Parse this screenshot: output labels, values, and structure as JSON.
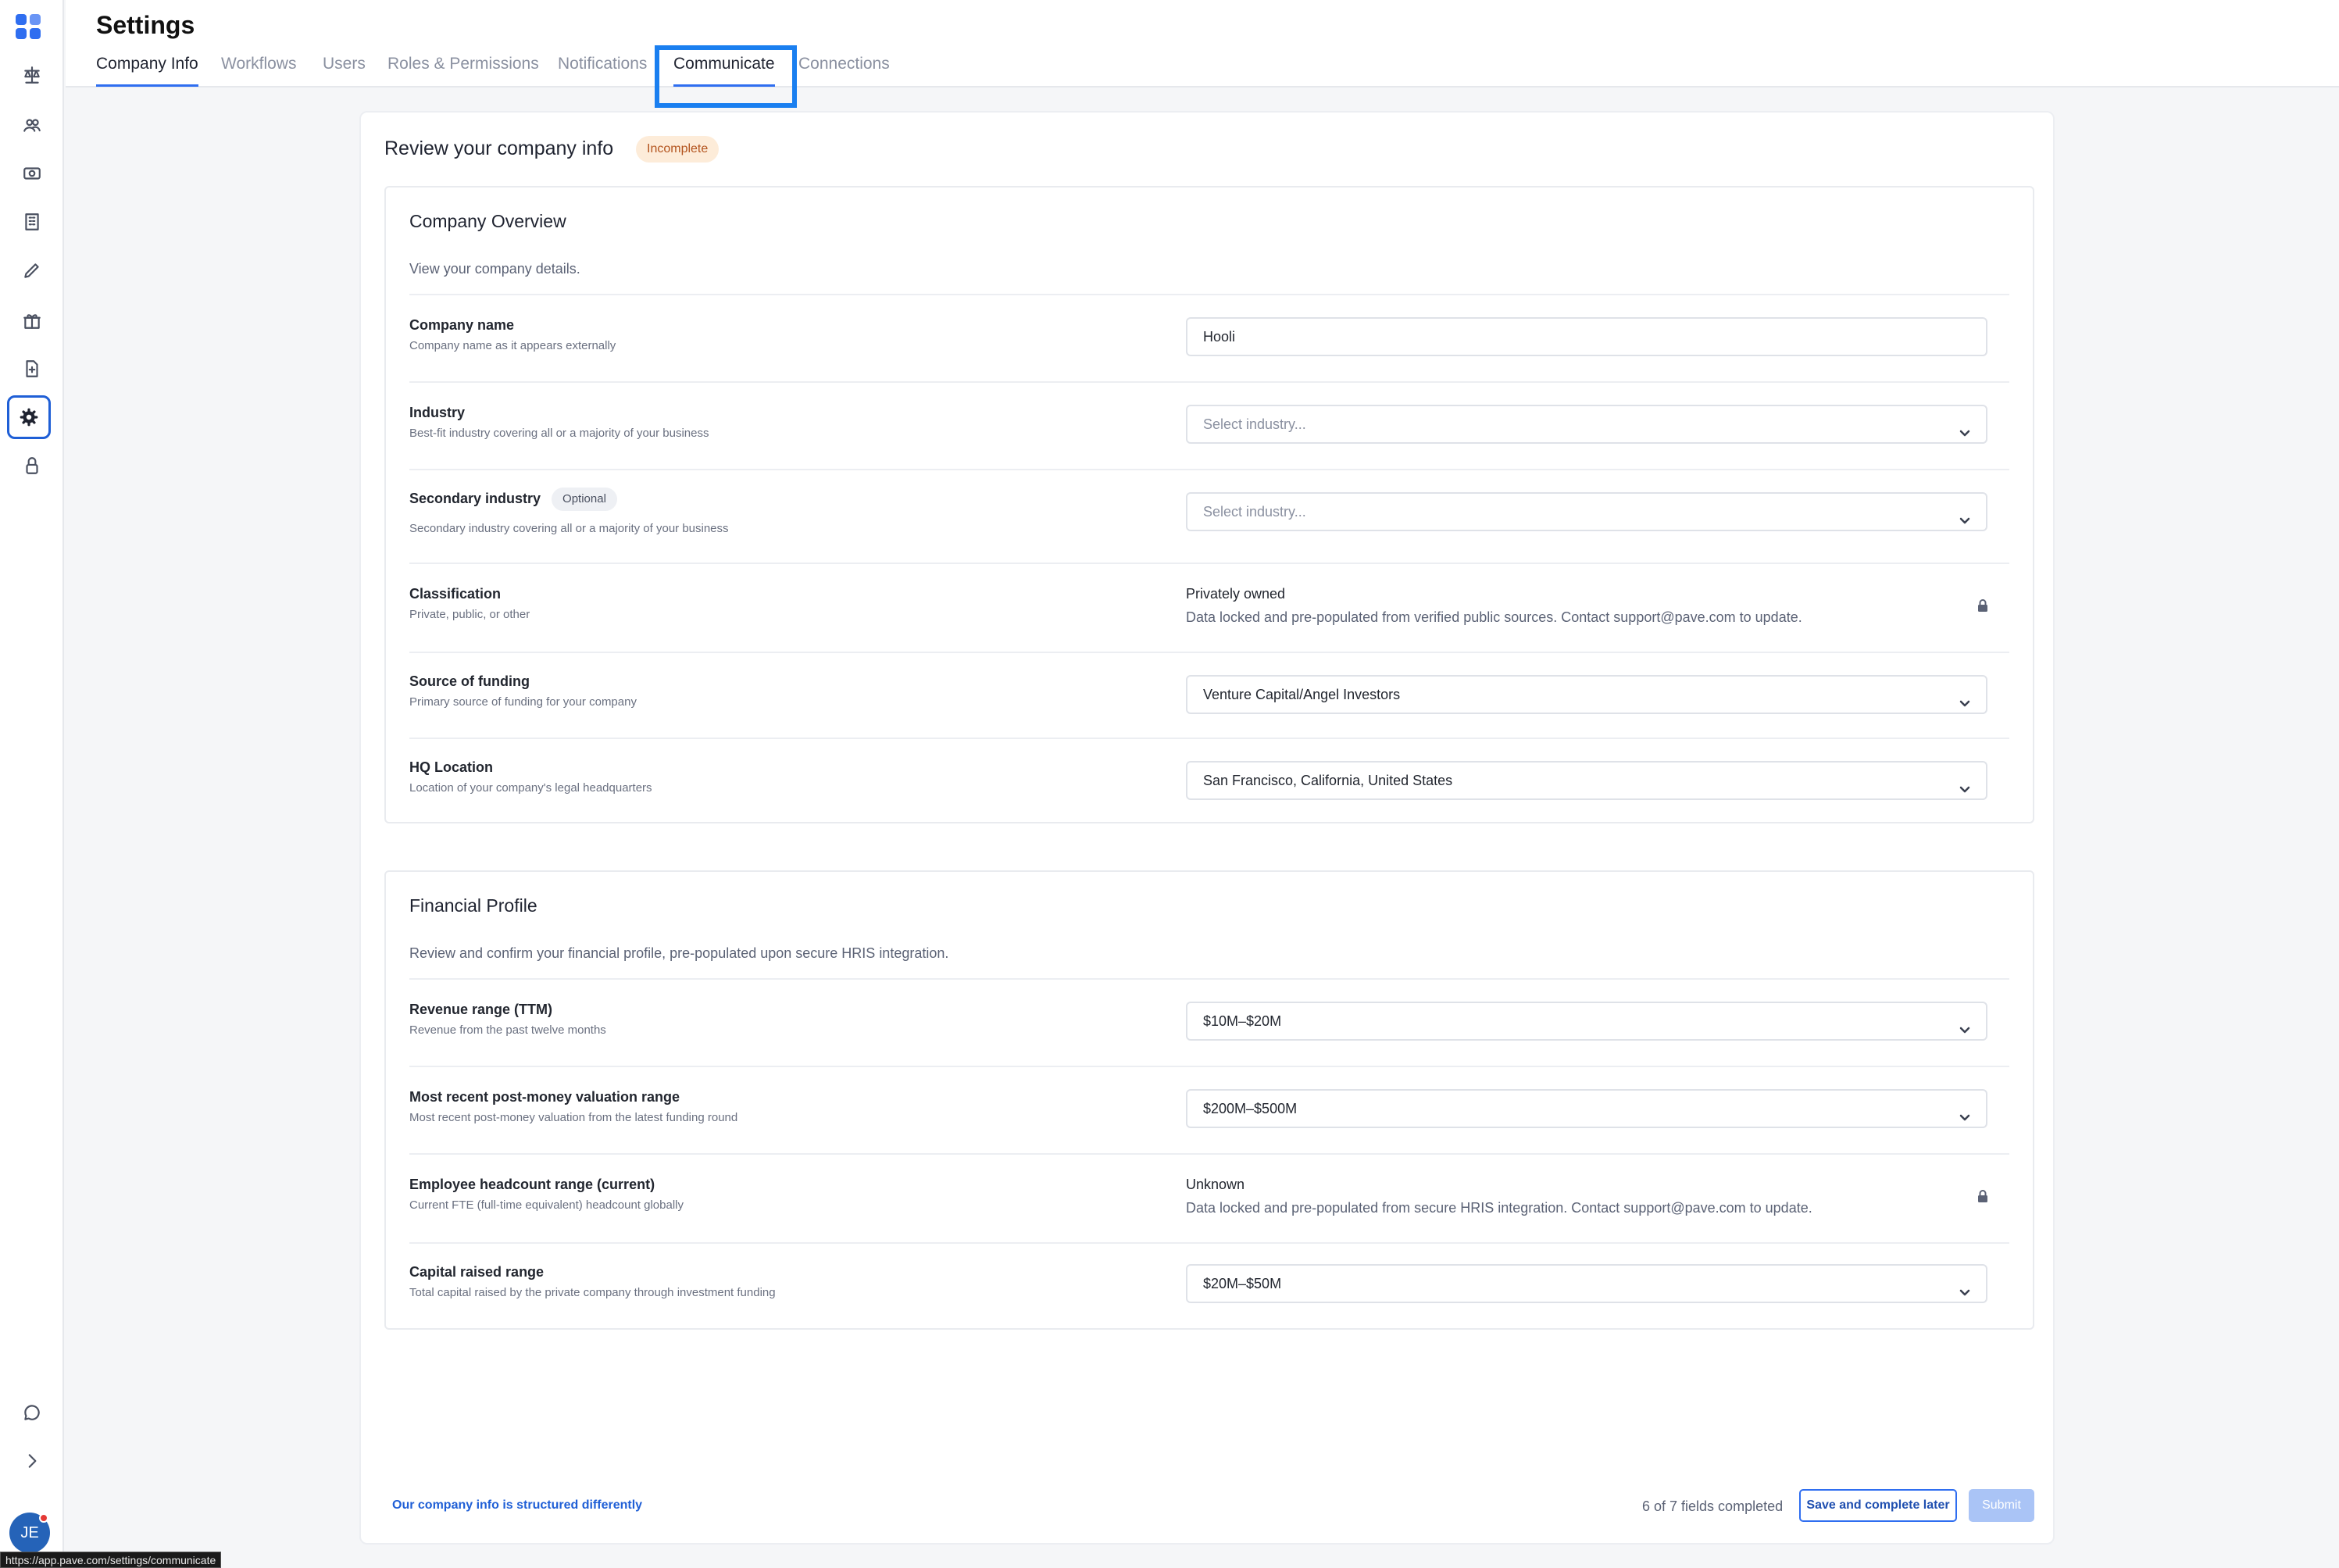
{
  "sidebar": {
    "icons": [
      "logo-icon",
      "scale-icon",
      "people-icon",
      "money-icon",
      "building-icon",
      "pencil-icon",
      "gift-icon",
      "document-icon",
      "gear-icon",
      "lock-icon",
      "chat-icon",
      "chevron-right-icon"
    ],
    "avatar_initials": "JE",
    "status_url": "https://app.pave.com/settings/communicate"
  },
  "header": {
    "title": "Settings",
    "tabs": [
      {
        "label": "Company Info",
        "active": true
      },
      {
        "label": "Workflows"
      },
      {
        "label": "Users"
      },
      {
        "label": "Roles & Permissions"
      },
      {
        "label": "Notifications"
      },
      {
        "label": "Communicate",
        "highlighted": true
      },
      {
        "label": "Connections"
      }
    ]
  },
  "card": {
    "title": "Review your company info",
    "status_badge": "Incomplete"
  },
  "overview": {
    "title": "Company Overview",
    "subtitle": "View your company details.",
    "company_name": {
      "label": "Company name",
      "desc": "Company name as it appears externally",
      "value": "Hooli"
    },
    "industry": {
      "label": "Industry",
      "desc": "Best-fit industry covering all or a majority of your business",
      "placeholder": "Select industry..."
    },
    "secondary_industry": {
      "label": "Secondary industry",
      "optional": "Optional",
      "desc": "Secondary industry covering all or a majority of your business",
      "placeholder": "Select industry..."
    },
    "classification": {
      "label": "Classification",
      "desc": "Private, public, or other",
      "value": "Privately owned",
      "note": "Data locked and pre-populated from verified public sources. Contact support@pave.com to update."
    },
    "funding": {
      "label": "Source of funding",
      "desc": "Primary source of funding for your company",
      "value": "Venture Capital/Angel Investors"
    },
    "hq": {
      "label": "HQ Location",
      "desc": "Location of your company's legal headquarters",
      "value": "San Francisco, California, United States"
    }
  },
  "financial": {
    "title": "Financial Profile",
    "subtitle": "Review and confirm your financial profile, pre-populated upon secure HRIS integration.",
    "revenue": {
      "label": "Revenue range (TTM)",
      "desc": "Revenue from the past twelve months",
      "value": "$10M–$20M"
    },
    "valuation": {
      "label": "Most recent post-money valuation range",
      "desc": "Most recent post-money valuation from the latest funding round",
      "value": "$200M–$500M"
    },
    "headcount": {
      "label": "Employee headcount range (current)",
      "desc": "Current FTE (full-time equivalent) headcount globally",
      "value": "Unknown",
      "note": "Data locked and pre-populated from secure HRIS integration. Contact support@pave.com to update."
    },
    "capital": {
      "label": "Capital raised range",
      "desc": "Total capital raised by the private company through investment funding",
      "value": "$20M–$50M"
    }
  },
  "footer": {
    "link": "Our company info is structured differently",
    "progress": "6 of 7 fields completed",
    "save_label": "Save and complete later",
    "submit_label": "Submit"
  }
}
